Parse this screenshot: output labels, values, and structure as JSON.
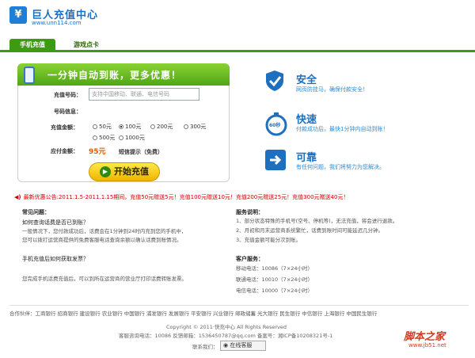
{
  "header": {
    "logo_char": "¥",
    "title": "巨人充值中心",
    "url": "www.unn114.com"
  },
  "tabs": [
    {
      "label": "手机充值",
      "active": true
    },
    {
      "label": "游戏点卡",
      "active": false
    }
  ],
  "panel": {
    "headline": "一分钟自动到账，更多优惠！",
    "phone_label": "充值号码：",
    "phone_placeholder": "支持中国移动、联通、电信号码",
    "info_label": "号码信息：",
    "amount_label": "充值金额：",
    "amounts": [
      "50元",
      "100元",
      "200元",
      "300元",
      "500元",
      "1000元"
    ],
    "selected_amount": "100元",
    "pay_label": "应付金额：",
    "pay_value": "95元",
    "sms_hint": "短信提示（免费）",
    "submit": "开始充值"
  },
  "features": [
    {
      "title": "安全",
      "desc": "网页防挂马，确保付款安全！",
      "icon": "shield-icon"
    },
    {
      "title": "快速",
      "desc": "付款成功后，最快1分钟内自动到账！",
      "icon": "stopwatch-icon",
      "badge": "60秒"
    },
    {
      "title": "可靠",
      "desc": "有任何问题，我们将努力为您解决。",
      "icon": "arrow-right-icon"
    }
  ],
  "notice": "最新优惠公告:2011.1.5-2011.1.15期间，充值50元赠送5元！充值100元赠送10元！充值200元赠送25元！充值300元赠送40元！",
  "faq": {
    "title": "常见问题：",
    "q1": "如何查询话费是否已到账？",
    "a1_line1": "一般情况下，您付款成功后，话费会在1分钟到24时内充到您的手机中，",
    "a1_line2": "您可以拨打运营商提供的免费客服电话查询余额以确认话费到账情况。",
    "q2": "手机充值后如何获取发票？",
    "a2": "您完成手机话费充值后，可以到所在运营商的营业厅打印话费转账发票。"
  },
  "service": {
    "title": "服务说明：",
    "items": [
      "1、部分状态特殊的手机号(空号、停机等)，无法充值，将会进行退款。",
      "2、月初和月末运营商系统繁忙，话费到账时间可能延迟几分钟。",
      "3、充值金额可能分次到账。"
    ],
    "cs_title": "客户服务：",
    "lines": [
      "移动电话：10086（7×24小时）",
      "联通电话：10010（7×24小时）",
      "电信电话：10000（7×24小时）"
    ]
  },
  "partners": "合作伙伴：工商银行  招商银行  建设银行  农业银行  中国银行  浦发银行  发展银行  平安银行  兴业银行  邮政储蓄  光大银行  民生银行  中信银行  上海银行  中国民生银行",
  "footer": {
    "copyright": "Copyright © 2011·快充中心 All Rights Reserved",
    "contact": "客服咨询电话：10086   反馈邮箱：1536450787@qq.com   备案号：湘ICP备10208321号-1",
    "contact_label": "联系我们：",
    "qq_button": "在线客服"
  },
  "watermark": {
    "text": "脚本之家",
    "url": "www.jb51.net"
  },
  "colors": {
    "brand_blue": "#1e6fc0",
    "tab_green": "#3d9a12",
    "notice_red": "#d00000",
    "price_orange": "#e25a00"
  }
}
